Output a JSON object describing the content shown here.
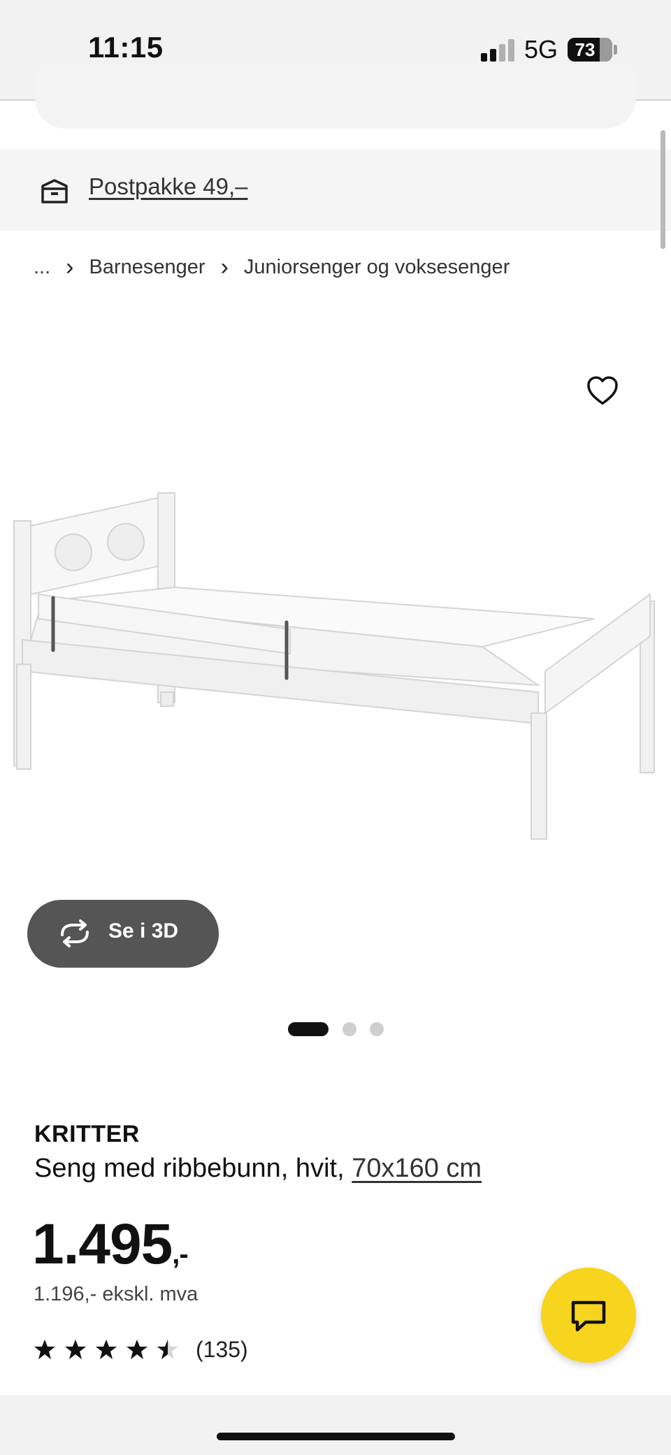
{
  "status_bar": {
    "time": "11:15",
    "network": "5G",
    "battery": "73",
    "battery_level": 0.73,
    "signal_bars": 2
  },
  "delivery": {
    "icon": "box-icon",
    "text": "Postpakke 49,–"
  },
  "breadcrumb": {
    "ellipsis": "...",
    "items": [
      "Barnesenger",
      "Juniorsenger og voksesenger"
    ]
  },
  "gallery": {
    "favorite_icon": "heart-icon",
    "view_3d_label": "Se i 3D",
    "view_3d_icon": "rotate-arrows-icon",
    "image_count": 3,
    "active_index": 0
  },
  "product": {
    "name": "KRITTER",
    "description": "Seng med ribbebunn, hvit, ",
    "size": "70x160 cm",
    "price": "1.495",
    "price_suffix": ",-",
    "price_excl_vat": "1.196,- ekskl. mva",
    "rating_value": 4.5,
    "rating_max": 5,
    "review_count": "(135)"
  },
  "chat": {
    "icon": "chat-bubble-icon"
  },
  "colors": {
    "chat_fab": "#f7d41d",
    "button_3d": "#555555",
    "background_strip": "#f5f5f5"
  }
}
